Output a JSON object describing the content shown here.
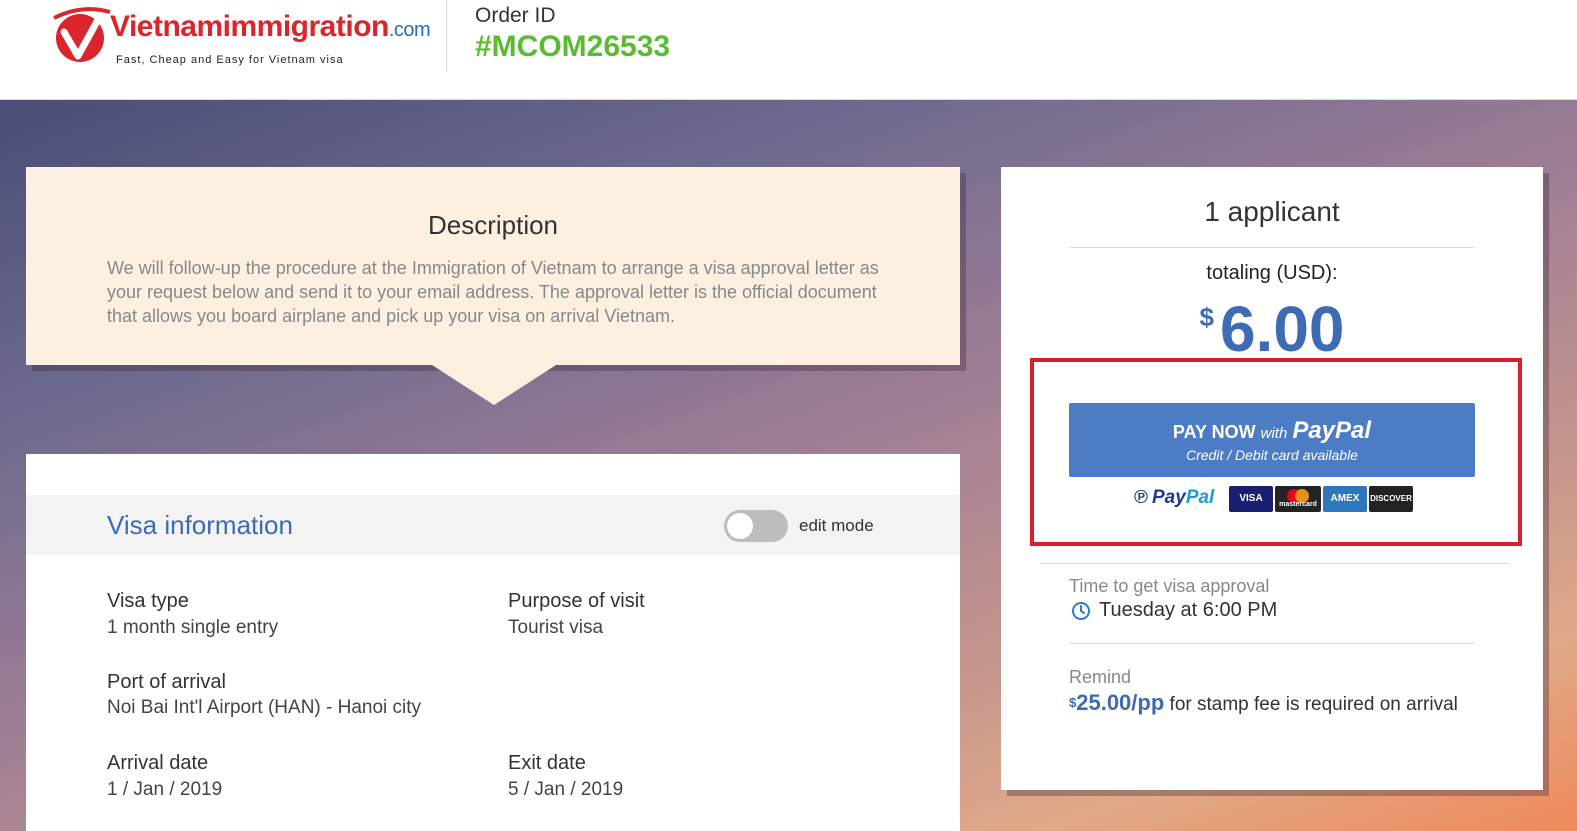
{
  "header": {
    "logo_name": "Vietnamimmigration",
    "logo_domain": ".com",
    "logo_tagline": "Fast, Cheap and Easy for Vietnam visa",
    "order_label": "Order ID",
    "order_id": "#MCOM26533"
  },
  "description": {
    "title": "Description",
    "text": "We will follow-up the procedure at the Immigration of Vietnam to arrange a visa approval letter as your request below and send it to your email address. The approval letter is the official document that allows you board airplane and pick up your visa on arrival Vietnam."
  },
  "visa": {
    "title": "Visa information",
    "edit_mode_label": "edit mode",
    "fields": [
      {
        "label": "Visa type",
        "value": "1 month single entry"
      },
      {
        "label": "Purpose of visit",
        "value": "Tourist visa"
      },
      {
        "label": "Port of arrival",
        "value": "Noi Bai Int'l Airport (HAN) - Hanoi city"
      },
      {
        "label": "Arrival date",
        "value": "1 / Jan / 2019"
      },
      {
        "label": "Exit date",
        "value": "5 / Jan / 2019"
      }
    ]
  },
  "summary": {
    "applicants": "1 applicant",
    "totaling_label": "totaling (USD):",
    "currency_symbol": "$",
    "total": "6.00",
    "paypal_button": {
      "pay_now": "PAY NOW",
      "with": "with",
      "brand": "PayPal",
      "subtitle": "Credit / Debit card available"
    },
    "payment_logos": {
      "paypal_pay": "Pay",
      "paypal_pal": "Pal",
      "visa": "VISA",
      "mastercard": "mastercard",
      "amex": "AMEX",
      "discover": "DISCOVER"
    },
    "time_label": "Time to get visa approval",
    "time_value": "Tuesday at 6:00 PM",
    "remind_label": "Remind",
    "remind_fee_currency": "$",
    "remind_fee": "25.00/pp",
    "remind_text": " for stamp fee is required on arrival"
  },
  "colors": {
    "accent_blue": "#3d6bb4",
    "order_green": "#5bbb30",
    "brand_red": "#d9252b",
    "highlight_red": "#d7202a",
    "paypal_button": "#4c7cc4"
  }
}
